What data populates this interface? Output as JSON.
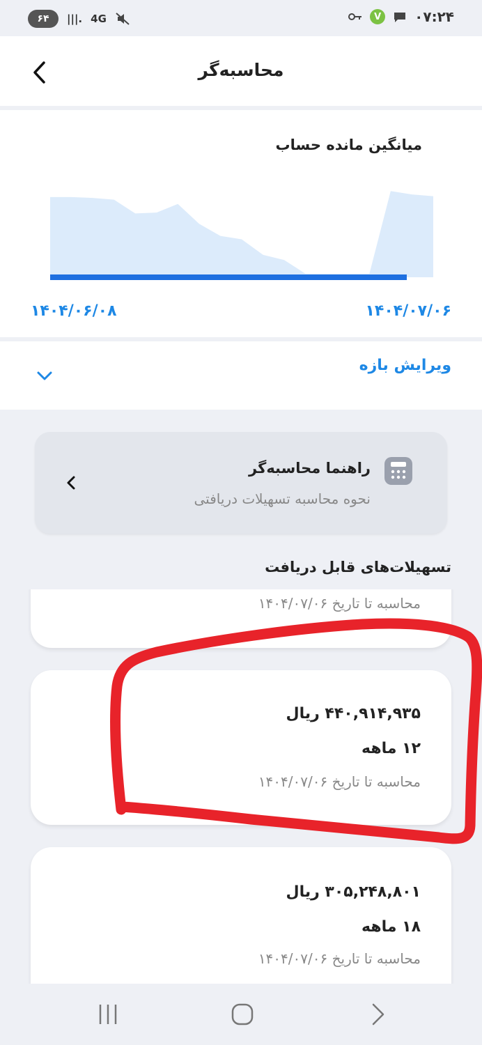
{
  "status_bar": {
    "battery": "۶۴",
    "network": "4G",
    "time": "۰۷:۲۴",
    "app_badge": "V"
  },
  "header": {
    "title": "محاسبه‌گر"
  },
  "chart": {
    "title": "میانگین مانده حساب",
    "start_date": "۱۴۰۴/۰۶/۰۸",
    "end_date": "۱۴۰۴/۰۷/۰۶"
  },
  "chart_data": {
    "type": "area",
    "title": "میانگین مانده حساب",
    "x_start": "۱۴۰۴/۰۶/۰۸",
    "x_end": "۱۴۰۴/۰۷/۰۶",
    "values": [
      93,
      93,
      92,
      90,
      74,
      75,
      85,
      62,
      48,
      44,
      26,
      20,
      4,
      4,
      4,
      4,
      100,
      96,
      94
    ],
    "ylim": [
      0,
      105
    ],
    "fill_color": "#dcebfb",
    "baseline_color": "#1e6fe0"
  },
  "edit_range": {
    "label": "ویرایش بازه"
  },
  "guide": {
    "title": "راهنما محاسبه‌گر",
    "subtitle": "نحوه محاسبه تسهیلات دریافتی"
  },
  "section": {
    "title": "تسهیلات‌های قابل دریافت"
  },
  "loans": [
    {
      "calc_note": "محاسبه تا تاریخ ۱۴۰۴/۰۷/۰۶"
    },
    {
      "amount": "۴۴۰,۹۱۴,۹۳۵ ریال",
      "term": "۱۲ ماهه",
      "calc_note": "محاسبه تا تاریخ ۱۴۰۴/۰۷/۰۶"
    },
    {
      "amount": "۳۰۵,۲۴۸,۸۰۱ ریال",
      "term": "۱۸ ماهه",
      "calc_note": "محاسبه تا تاریخ ۱۴۰۴/۰۷/۰۶"
    }
  ],
  "colors": {
    "accent": "#1e88e5",
    "annotation": "#e8232a"
  }
}
